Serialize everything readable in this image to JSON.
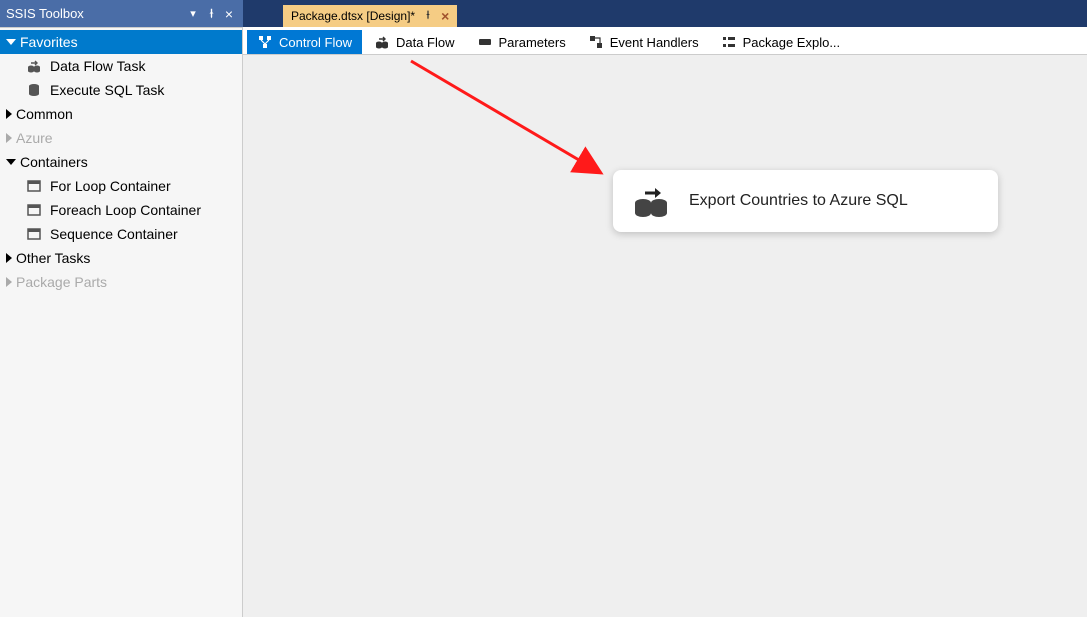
{
  "toolbox": {
    "title": "SSIS Toolbox",
    "categories": [
      {
        "label": "Favorites",
        "selected": true,
        "expanded": true,
        "enabled": true,
        "items": [
          {
            "label": "Data Flow Task",
            "icon": "dataflow"
          },
          {
            "label": "Execute SQL Task",
            "icon": "sql"
          }
        ]
      },
      {
        "label": "Common",
        "expanded": false,
        "enabled": true,
        "items": []
      },
      {
        "label": "Azure",
        "expanded": false,
        "enabled": false,
        "items": []
      },
      {
        "label": "Containers",
        "expanded": true,
        "enabled": true,
        "items": [
          {
            "label": "For Loop Container",
            "icon": "container"
          },
          {
            "label": "Foreach Loop Container",
            "icon": "container"
          },
          {
            "label": "Sequence Container",
            "icon": "container"
          }
        ]
      },
      {
        "label": "Other Tasks",
        "expanded": false,
        "enabled": true,
        "items": []
      },
      {
        "label": "Package Parts",
        "expanded": false,
        "enabled": false,
        "items": []
      }
    ]
  },
  "file_tab": {
    "label": "Package.dtsx [Design]*"
  },
  "design_tabs": [
    {
      "label": "Control Flow",
      "icon": "controlflow",
      "active": true
    },
    {
      "label": "Data Flow",
      "icon": "dataflow",
      "active": false
    },
    {
      "label": "Parameters",
      "icon": "parameters",
      "active": false
    },
    {
      "label": "Event Handlers",
      "icon": "eventhandlers",
      "active": false
    },
    {
      "label": "Package Explo...",
      "icon": "explorer",
      "active": false
    }
  ],
  "canvas": {
    "task_label": "Export Countries to Azure SQL"
  }
}
